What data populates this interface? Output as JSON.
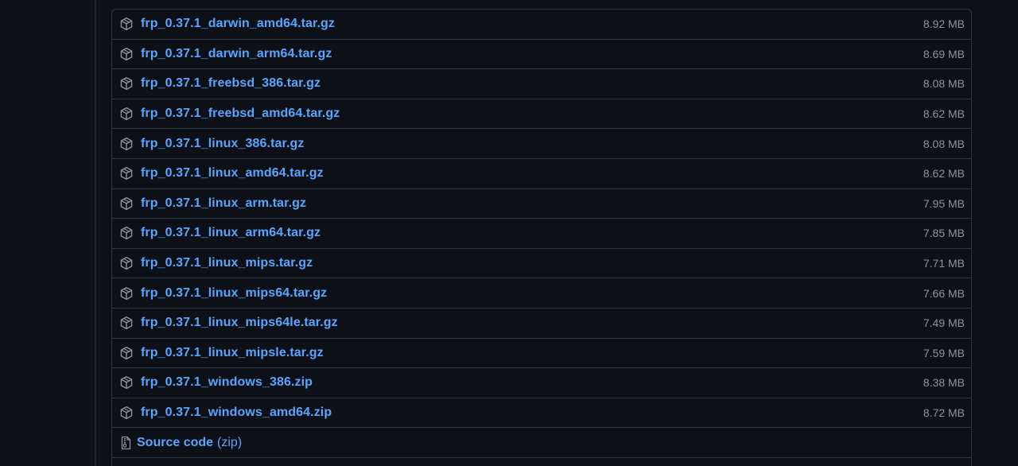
{
  "assets": [
    {
      "name": "frp_0.37.1_darwin_amd64.tar.gz",
      "size": "8.92 MB",
      "icon": "package-icon"
    },
    {
      "name": "frp_0.37.1_darwin_arm64.tar.gz",
      "size": "8.69 MB",
      "icon": "package-icon"
    },
    {
      "name": "frp_0.37.1_freebsd_386.tar.gz",
      "size": "8.08 MB",
      "icon": "package-icon"
    },
    {
      "name": "frp_0.37.1_freebsd_amd64.tar.gz",
      "size": "8.62 MB",
      "icon": "package-icon"
    },
    {
      "name": "frp_0.37.1_linux_386.tar.gz",
      "size": "8.08 MB",
      "icon": "package-icon"
    },
    {
      "name": "frp_0.37.1_linux_amd64.tar.gz",
      "size": "8.62 MB",
      "icon": "package-icon"
    },
    {
      "name": "frp_0.37.1_linux_arm.tar.gz",
      "size": "7.95 MB",
      "icon": "package-icon"
    },
    {
      "name": "frp_0.37.1_linux_arm64.tar.gz",
      "size": "7.85 MB",
      "icon": "package-icon"
    },
    {
      "name": "frp_0.37.1_linux_mips.tar.gz",
      "size": "7.71 MB",
      "icon": "package-icon"
    },
    {
      "name": "frp_0.37.1_linux_mips64.tar.gz",
      "size": "7.66 MB",
      "icon": "package-icon"
    },
    {
      "name": "frp_0.37.1_linux_mips64le.tar.gz",
      "size": "7.49 MB",
      "icon": "package-icon"
    },
    {
      "name": "frp_0.37.1_linux_mipsle.tar.gz",
      "size": "7.59 MB",
      "icon": "package-icon"
    },
    {
      "name": "frp_0.37.1_windows_386.zip",
      "size": "8.38 MB",
      "icon": "package-icon"
    },
    {
      "name": "frp_0.37.1_windows_amd64.zip",
      "size": "8.72 MB",
      "icon": "package-icon"
    }
  ],
  "source": {
    "label": "Source code",
    "format": "(zip)",
    "icon": "file-zip-icon"
  },
  "colors": {
    "background": "#0d1117",
    "border": "#30363d",
    "link": "#58a6ff",
    "muted": "#8b949e"
  }
}
